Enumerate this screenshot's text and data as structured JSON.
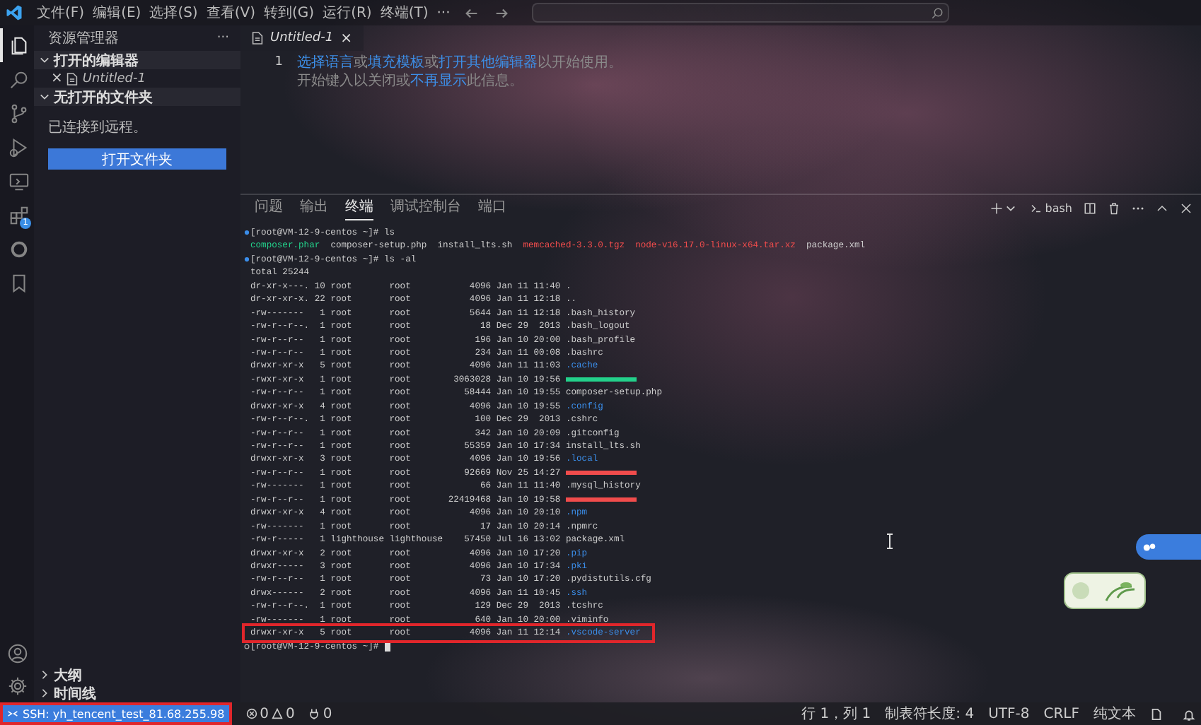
{
  "title_bar": {
    "menus": [
      "文件(F)",
      "编辑(E)",
      "选择(S)",
      "查看(V)",
      "转到(G)",
      "运行(R)",
      "终端(T)"
    ],
    "overflow": "···"
  },
  "activity_bar": {
    "items": [
      {
        "kind": "explorer",
        "selected": true
      },
      {
        "kind": "search",
        "selected": false
      },
      {
        "kind": "source-control",
        "selected": false
      },
      {
        "kind": "run-debug",
        "selected": false
      },
      {
        "kind": "remote",
        "selected": false
      },
      {
        "kind": "extensions",
        "selected": false,
        "badge": "1"
      },
      {
        "kind": "circle",
        "selected": false
      },
      {
        "kind": "bookmark",
        "selected": false
      }
    ]
  },
  "sidebar": {
    "title": "资源管理器",
    "more": "···",
    "open_editors": {
      "label": "打开的编辑器",
      "expanded": true,
      "items": [
        {
          "name": "Untitled-1",
          "close": "×"
        }
      ]
    },
    "folder": {
      "label": "无打开的文件夹",
      "expanded": true,
      "message": "已连接到远程。",
      "button": "打开文件夹"
    },
    "bottom_sections": [
      {
        "label": "大纲",
        "expanded": false
      },
      {
        "label": "时间线",
        "expanded": false
      }
    ]
  },
  "editor": {
    "tabs": [
      {
        "label": "Untitled-1",
        "close": "×",
        "selected": true
      }
    ],
    "line_number": "1",
    "hint_lines": [
      [
        {
          "kind": "link",
          "text": "选择语言"
        },
        {
          "kind": "text",
          "text": "或"
        },
        {
          "kind": "link",
          "text": "填充模板"
        },
        {
          "kind": "text",
          "text": "或"
        },
        {
          "kind": "link",
          "text": "打开其他编辑器"
        },
        {
          "kind": "text",
          "text": "以开始使用。"
        }
      ],
      [
        {
          "kind": "text",
          "text": "开始键入以关闭或"
        },
        {
          "kind": "link",
          "text": "不再显示"
        },
        {
          "kind": "text",
          "text": "此信息。"
        }
      ]
    ]
  },
  "panel": {
    "tabs": [
      {
        "label": "问题",
        "selected": false
      },
      {
        "label": "输出",
        "selected": false
      },
      {
        "label": "终端",
        "selected": true
      },
      {
        "label": "调试控制台",
        "selected": false
      },
      {
        "label": "端口",
        "selected": false
      }
    ],
    "shell": "bash",
    "lines": [
      {
        "kind": "prompt",
        "done": true,
        "text": "[root@VM-12-9-centos ~]# ls"
      },
      {
        "kind": "ls",
        "items": [
          {
            "name": "composer.phar",
            "color": "#23d18b"
          },
          {
            "name": "composer-setup.php",
            "color": "#cccccc"
          },
          {
            "name": "install_lts.sh",
            "color": "#cccccc"
          },
          {
            "name": "memcached-3.3.0.tgz",
            "color": "#f14c4c"
          },
          {
            "name": "node-v16.17.0-linux-x64.tar.xz",
            "color": "#f14c4c"
          },
          {
            "name": "package.xml",
            "color": "#cccccc"
          }
        ]
      },
      {
        "kind": "prompt",
        "done": true,
        "text": "[root@VM-12-9-centos ~]# ls -al"
      },
      {
        "kind": "plain",
        "text": "total 25244"
      },
      {
        "kind": "entry",
        "perms": "dr-xr-x---.",
        "links": "10",
        "owner": "root",
        "group": "root",
        "size": "4096",
        "date": "Jan 11 11:40",
        "name": ".",
        "highlighted": false
      },
      {
        "kind": "entry",
        "perms": "dr-xr-xr-x.",
        "links": "22",
        "owner": "root",
        "group": "root",
        "size": "4096",
        "date": "Jan 11 12:18",
        "name": "..",
        "highlighted": false
      },
      {
        "kind": "entry",
        "perms": "-rw-------",
        "links": "1",
        "owner": "root",
        "group": "root",
        "size": "5644",
        "date": "Jan 11 12:18",
        "name": ".bash_history",
        "color": "#cccccc",
        "highlighted": false
      },
      {
        "kind": "entry",
        "perms": "-rw-r--r--.",
        "links": "1",
        "owner": "root",
        "group": "root",
        "size": "18",
        "date": "Dec 29  2013",
        "name": ".bash_logout",
        "color": "#cccccc",
        "highlighted": false
      },
      {
        "kind": "entry",
        "perms": "-rw-r--r--",
        "links": "1",
        "owner": "root",
        "group": "root",
        "size": "196",
        "date": "Jan 10 20:00",
        "name": ".bash_profile",
        "color": "#cccccc",
        "highlighted": false
      },
      {
        "kind": "entry",
        "perms": "-rw-r--r--",
        "links": "1",
        "owner": "root",
        "group": "root",
        "size": "234",
        "date": "Jan 11 00:08",
        "name": ".bashrc",
        "color": "#cccccc",
        "highlighted": false
      },
      {
        "kind": "entry",
        "perms": "drwxr-xr-x",
        "links": "5",
        "owner": "root",
        "group": "root",
        "size": "4096",
        "date": "Jan 11 11:03",
        "name": ".cache",
        "color": "#3b8eea",
        "highlighted": false
      },
      {
        "kind": "entry",
        "perms": "-rwxr-xr-x",
        "links": "1",
        "owner": "root",
        "group": "root",
        "size": "3063028",
        "date": "Jan 10 19:56",
        "redacted": true,
        "color": "#23d18b",
        "highlighted": false
      },
      {
        "kind": "entry",
        "perms": "-rw-r--r--",
        "links": "1",
        "owner": "root",
        "group": "root",
        "size": "58444",
        "date": "Jan 10 19:55",
        "name": "composer-setup.php",
        "color": "#cccccc",
        "highlighted": false
      },
      {
        "kind": "entry",
        "perms": "drwxr-xr-x",
        "links": "4",
        "owner": "root",
        "group": "root",
        "size": "4096",
        "date": "Jan 10 19:55",
        "name": ".config",
        "color": "#3b8eea",
        "highlighted": false
      },
      {
        "kind": "entry",
        "perms": "-rw-r--r--.",
        "links": "1",
        "owner": "root",
        "group": "root",
        "size": "100",
        "date": "Dec 29  2013",
        "name": ".cshrc",
        "color": "#cccccc",
        "highlighted": false
      },
      {
        "kind": "entry",
        "perms": "-rw-r--r--",
        "links": "1",
        "owner": "root",
        "group": "root",
        "size": "342",
        "date": "Jan 10 20:09",
        "name": ".gitconfig",
        "color": "#cccccc",
        "highlighted": false
      },
      {
        "kind": "entry",
        "perms": "-rw-r--r--",
        "links": "1",
        "owner": "root",
        "group": "root",
        "size": "55359",
        "date": "Jan 10 17:34",
        "name": "install_lts.sh",
        "color": "#cccccc",
        "highlighted": false
      },
      {
        "kind": "entry",
        "perms": "drwxr-xr-x",
        "links": "3",
        "owner": "root",
        "group": "root",
        "size": "4096",
        "date": "Jan 10 19:56",
        "name": ".local",
        "color": "#3b8eea",
        "highlighted": false
      },
      {
        "kind": "entry",
        "perms": "-rw-r--r--",
        "links": "1",
        "owner": "root",
        "group": "root",
        "size": "92669",
        "date": "Nov 25 14:27",
        "redacted": true,
        "color": "#f14c4c",
        "highlighted": false
      },
      {
        "kind": "entry",
        "perms": "-rw-------",
        "links": "1",
        "owner": "root",
        "group": "root",
        "size": "66",
        "date": "Jan 11 11:40",
        "name": ".mysql_history",
        "color": "#cccccc",
        "highlighted": false
      },
      {
        "kind": "entry",
        "perms": "-rw-r--r--",
        "links": "1",
        "owner": "root",
        "group": "root",
        "size": "22419468",
        "date": "Jan 10 19:58",
        "redacted": true,
        "color": "#f14c4c",
        "highlighted": false
      },
      {
        "kind": "entry",
        "perms": "drwxr-xr-x",
        "links": "4",
        "owner": "root",
        "group": "root",
        "size": "4096",
        "date": "Jan 10 20:10",
        "name": ".npm",
        "color": "#3b8eea",
        "highlighted": false
      },
      {
        "kind": "entry",
        "perms": "-rw-------",
        "links": "1",
        "owner": "root",
        "group": "root",
        "size": "17",
        "date": "Jan 10 20:14",
        "name": ".npmrc",
        "color": "#cccccc",
        "highlighted": false
      },
      {
        "kind": "entry",
        "perms": "-rw-r-----",
        "links": "1",
        "owner": "lighthouse",
        "group": "lighthouse",
        "size": "57450",
        "date": "Jul 16 13:02",
        "name": "package.xml",
        "color": "#cccccc",
        "highlighted": false
      },
      {
        "kind": "entry",
        "perms": "drwxr-xr-x",
        "links": "2",
        "owner": "root",
        "group": "root",
        "size": "4096",
        "date": "Jan 10 17:20",
        "name": ".pip",
        "color": "#3b8eea",
        "highlighted": false
      },
      {
        "kind": "entry",
        "perms": "drwxr-----",
        "links": "3",
        "owner": "root",
        "group": "root",
        "size": "4096",
        "date": "Jan 10 17:34",
        "name": ".pki",
        "color": "#3b8eea",
        "highlighted": false
      },
      {
        "kind": "entry",
        "perms": "-rw-r--r--",
        "links": "1",
        "owner": "root",
        "group": "root",
        "size": "73",
        "date": "Jan 10 17:20",
        "name": ".pydistutils.cfg",
        "color": "#cccccc",
        "highlighted": false
      },
      {
        "kind": "entry",
        "perms": "drwx------",
        "links": "2",
        "owner": "root",
        "group": "root",
        "size": "4096",
        "date": "Jan 11 10:45",
        "name": ".ssh",
        "color": "#3b8eea",
        "highlighted": false
      },
      {
        "kind": "entry",
        "perms": "-rw-r--r--.",
        "links": "1",
        "owner": "root",
        "group": "root",
        "size": "129",
        "date": "Dec 29  2013",
        "name": ".tcshrc",
        "color": "#cccccc",
        "highlighted": false
      },
      {
        "kind": "entry",
        "perms": "-rw-------",
        "links": "1",
        "owner": "root",
        "group": "root",
        "size": "640",
        "date": "Jan 10 20:00",
        "name": ".viminfo",
        "color": "#cccccc",
        "highlighted": false
      },
      {
        "kind": "entry",
        "perms": "drwxr-xr-x",
        "links": "5",
        "owner": "root",
        "group": "root",
        "size": "4096",
        "date": "Jan 11 12:14",
        "name": ".vscode-server",
        "color": "#3b8eea",
        "highlighted": true
      },
      {
        "kind": "prompt",
        "done": false,
        "text": "[root@VM-12-9-centos ~]#",
        "cursor": true
      }
    ]
  },
  "status_bar": {
    "remote": {
      "label": "SSH: yh_tencent_test_81.68.255.98",
      "highlighted": true
    },
    "errors": "0",
    "warnings": "0",
    "ports": "0",
    "right": [
      "行 1，列 1",
      "制表符长度: 4",
      "UTF-8",
      "CRLF",
      "纯文本"
    ]
  }
}
